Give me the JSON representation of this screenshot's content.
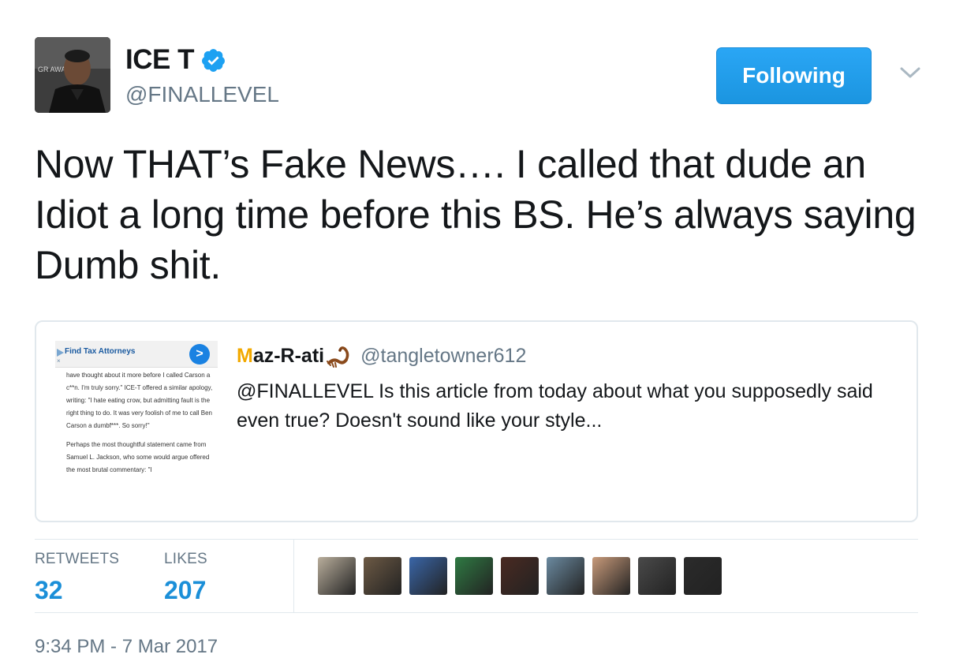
{
  "author": {
    "display_name": "ICE T",
    "handle": "@FINALLEVEL",
    "verified": true,
    "avatar_text": "GR       AWA"
  },
  "follow_button": {
    "label": "Following"
  },
  "tweet": {
    "text": "Now THAT’s Fake News….  I called that dude an Idiot a long time before this BS. He’s always saying Dumb shit."
  },
  "quoted_tweet": {
    "thumbnail": {
      "ad_title": "Find Tax Attorneys",
      "ad_arrow": ">",
      "ad_close": "×",
      "paragraphs": [
        "have thought about it more before I called Carson a c**n. I'm truly sorry.\" ICE-T offered a similar apology, writing: \"I hate eating crow, but admitting fault is the right thing to do. It was very foolish of me to call Ben Carson a dumbf***. So sorry!\"",
        "Perhaps the most thoughtful statement came from Samuel L. Jackson, who some would argue offered the most brutal commentary: \"I"
      ]
    },
    "name_prefix": "M",
    "name_rest": "az-R-ati",
    "handle": "@tangletowner612",
    "text": "@FINALLEVEL Is this article from today about what you supposedly said even true? Doesn't sound like your style..."
  },
  "stats": {
    "retweets_label": "RETWEETS",
    "retweets_value": "32",
    "likes_label": "LIKES",
    "likes_value": "207"
  },
  "likers": [
    {
      "color": "#b9ae9c"
    },
    {
      "color": "#6d5a45"
    },
    {
      "color": "#3a66a8"
    },
    {
      "color": "#2f7a43"
    },
    {
      "color": "#4a2a22"
    },
    {
      "color": "#6b8aa0"
    },
    {
      "color": "#c89a7a"
    },
    {
      "color": "#4a4a4a"
    },
    {
      "color": "#2b2b2b"
    }
  ],
  "timestamp": "9:34 PM - 7 Mar 2017",
  "colors": {
    "accent": "#1da1f2",
    "verified": "#1da1f2",
    "muted": "#657786",
    "stat_value": "#1b8fd8"
  }
}
